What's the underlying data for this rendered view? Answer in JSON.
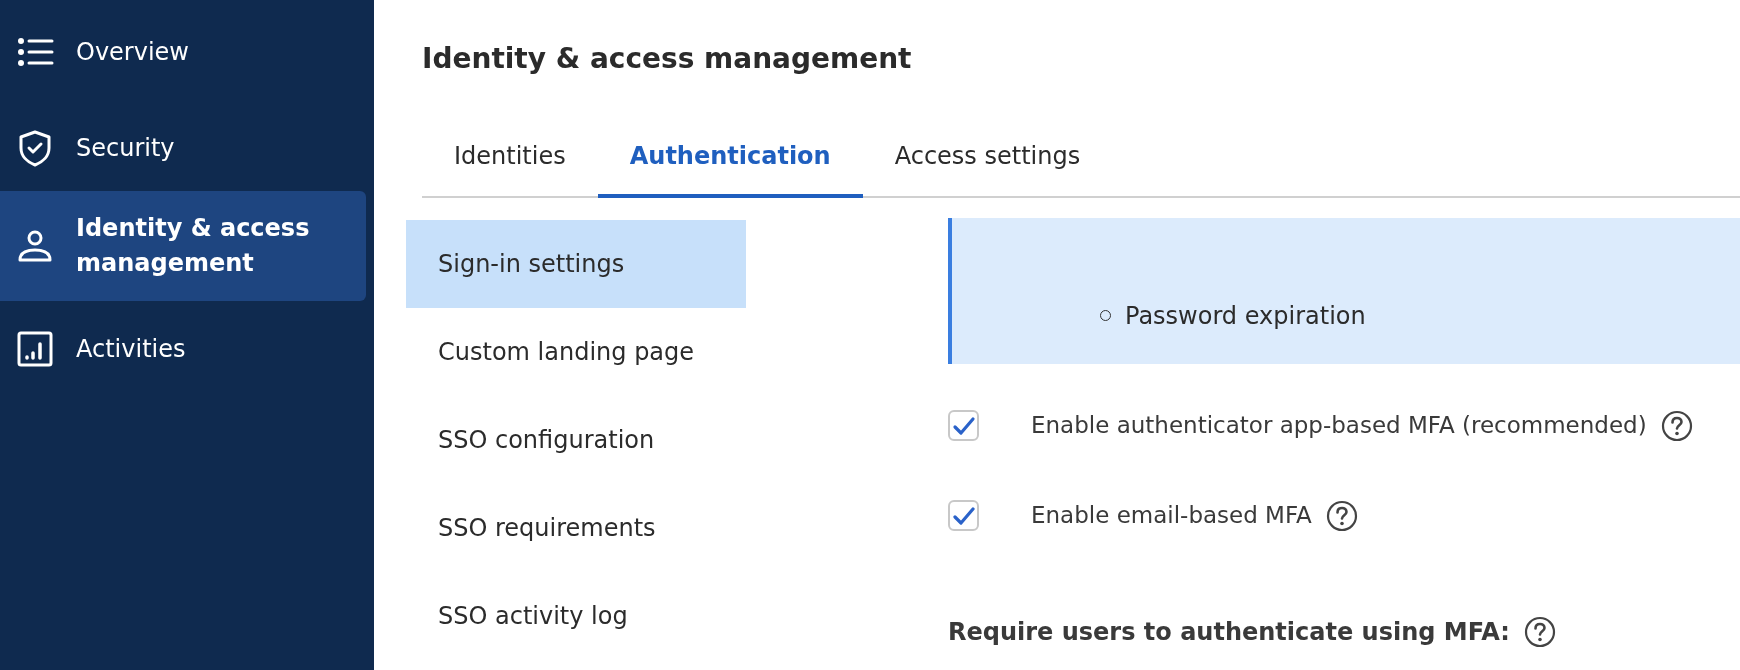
{
  "sidebar": {
    "items": [
      {
        "label": "Overview",
        "selected": false
      },
      {
        "label": "Security",
        "selected": false
      },
      {
        "label": "Identity & access management",
        "selected": true
      },
      {
        "label": "Activities",
        "selected": false
      }
    ]
  },
  "page_title": "Identity & access management",
  "tabs": [
    {
      "label": "Identities",
      "selected": false
    },
    {
      "label": "Authentication",
      "selected": true
    },
    {
      "label": "Access settings",
      "selected": false
    }
  ],
  "subnav": [
    {
      "label": "Sign-in settings",
      "selected": true
    },
    {
      "label": "Custom landing page",
      "selected": false
    },
    {
      "label": "SSO configuration",
      "selected": false
    },
    {
      "label": "SSO requirements",
      "selected": false
    },
    {
      "label": "SSO activity log",
      "selected": false
    }
  ],
  "callout": {
    "list_items": [
      "Password expiration"
    ]
  },
  "options": [
    {
      "label": "Enable authenticator app-based MFA (recommended)",
      "checked": true
    },
    {
      "label": "Enable email-based MFA",
      "checked": true
    }
  ],
  "section_heading": "Require users to authenticate using MFA:"
}
